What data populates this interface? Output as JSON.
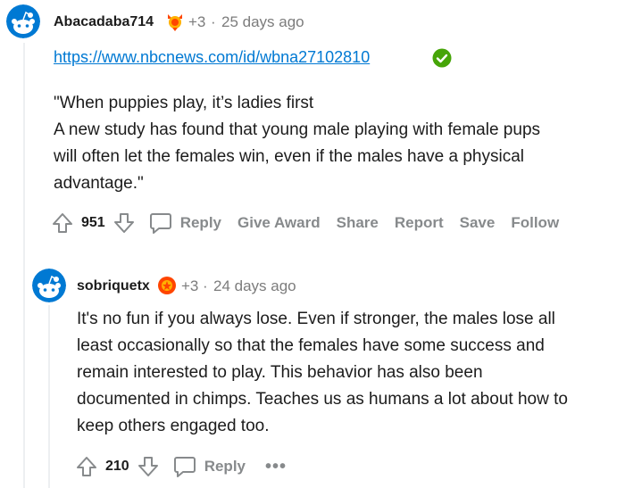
{
  "comments": [
    {
      "username": "Abacadaba714",
      "award_count": "+3",
      "separator": "·",
      "time": "25 days ago",
      "link": "https://www.nbcnews.com/id/wbna27102810",
      "body": [
        "\"When puppies play, it’s ladies first",
        "A new study has found that young male playing with female pups",
        "will often let the females win, even if the males have a physical",
        "advantage.\""
      ],
      "score": "951",
      "actions": [
        "Reply",
        "Give Award",
        "Share",
        "Report",
        "Save",
        "Follow"
      ]
    },
    {
      "username": "sobriquetx",
      "award_count": "+3",
      "separator": "·",
      "time": "24 days ago",
      "body": [
        "It's no fun if you always lose. Even if stronger, the males lose all",
        "least occasionally so that the females have some success and",
        "remain interested to play. This behavior has also been",
        "documented in chimps. Teaches us as humans a lot about how to",
        "keep others engaged too."
      ],
      "score": "210",
      "actions": [
        "Reply"
      ],
      "more": "•••"
    }
  ],
  "icons": {
    "avatar": "snoo-avatar-icon",
    "award": "award-icon",
    "verified": "check-circle-icon",
    "upvote": "upvote-icon",
    "downvote": "downvote-icon",
    "comment": "comment-bubble-icon"
  },
  "colors": {
    "link": "#0079d3",
    "verified": "#46a508",
    "muted": "#7c7c7c",
    "avatar_bg": "#0079d3"
  }
}
